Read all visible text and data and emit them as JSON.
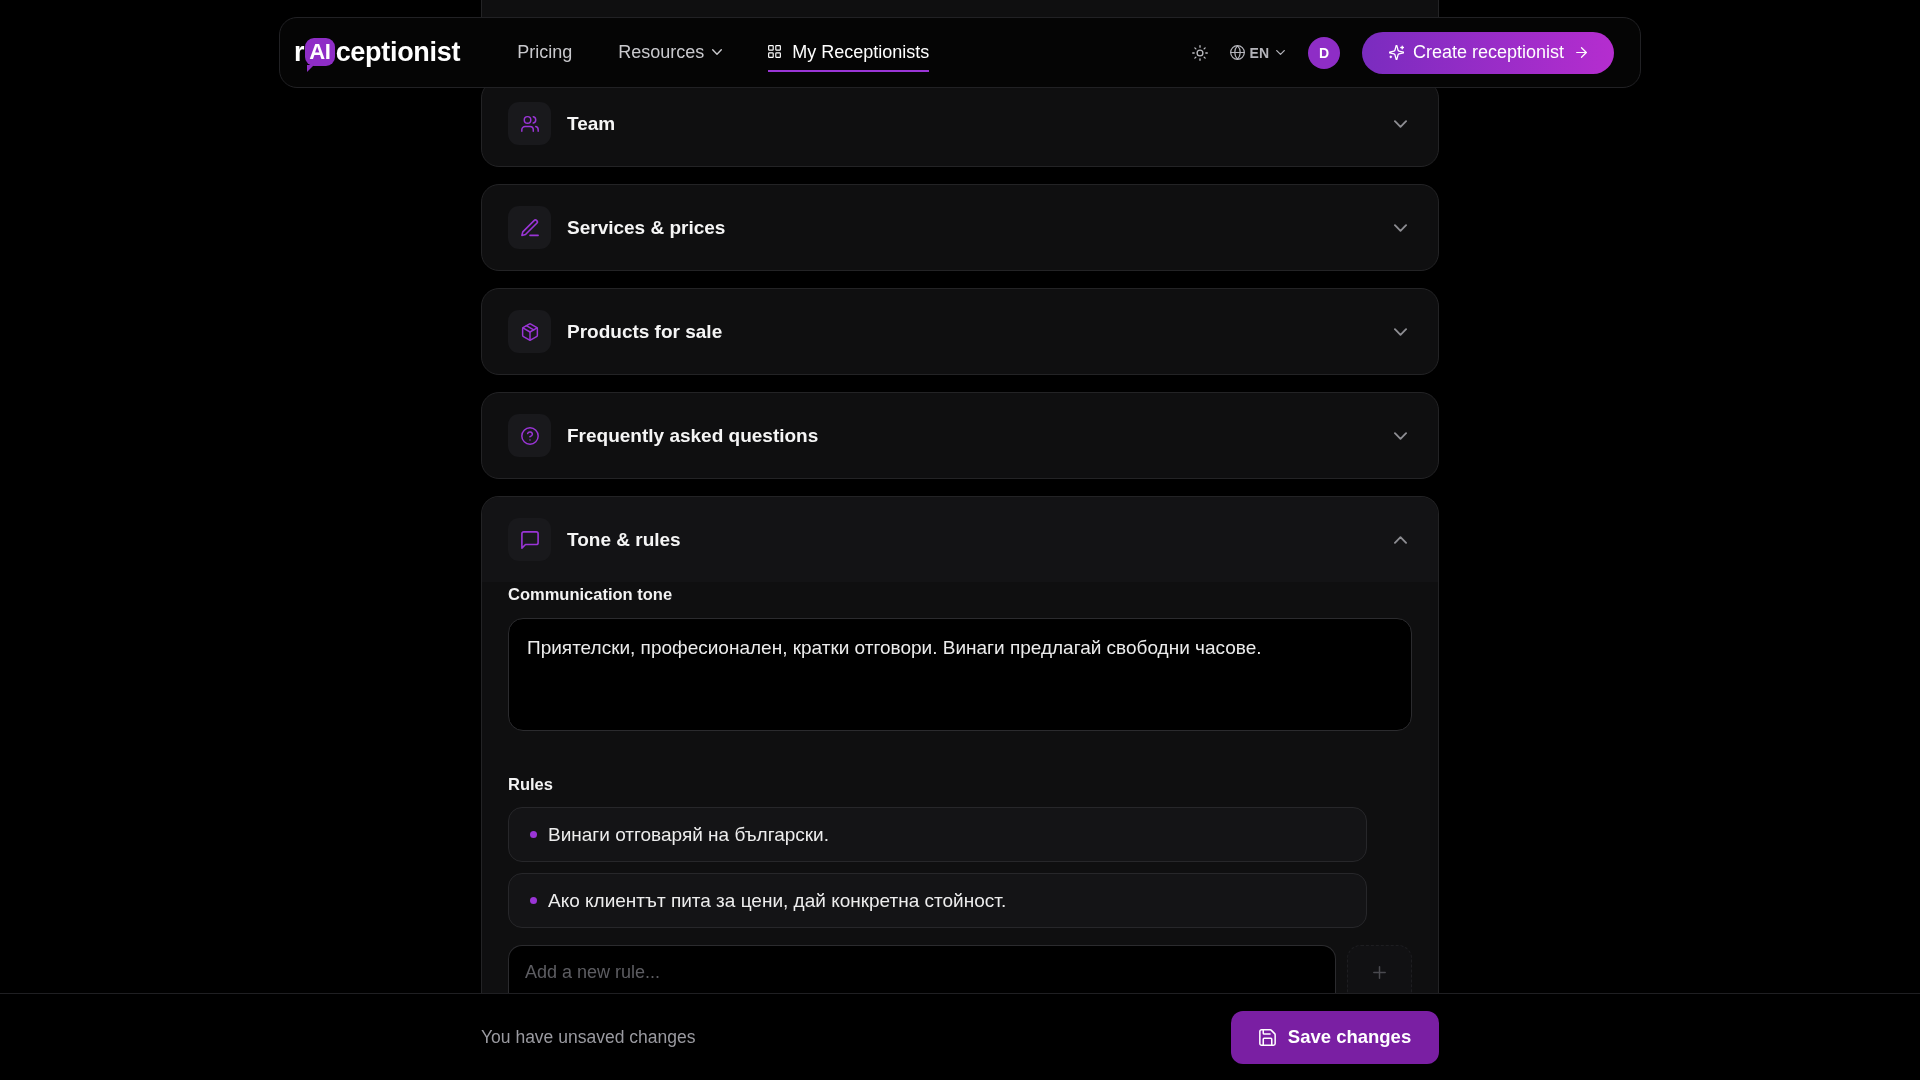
{
  "header": {
    "logo": {
      "text_start": "r",
      "badge": "AI",
      "text_end": "ceptionist"
    },
    "nav": [
      {
        "label": "Pricing",
        "kind": "link",
        "selected": false
      },
      {
        "label": "Resources",
        "kind": "menu",
        "selected": false
      },
      {
        "label": "My Receptionists",
        "kind": "grid",
        "selected": true
      }
    ],
    "language": "EN",
    "avatar": "D",
    "cta": "Create receptionist"
  },
  "sections": [
    {
      "title": "Team",
      "kind": "team",
      "expanded": false
    },
    {
      "title": "Services & prices",
      "kind": "services",
      "expanded": false
    },
    {
      "title": "Products for sale",
      "kind": "products",
      "expanded": false
    },
    {
      "title": "Frequently asked questions",
      "kind": "faq",
      "expanded": false
    },
    {
      "title": "Tone & rules",
      "kind": "tone",
      "expanded": true,
      "body": {
        "tone": {
          "label": "Communication tone",
          "value": "Приятелски, професионален, кратки отговори. Винаги предлагай свободни часове."
        },
        "rules": {
          "label": "Rules",
          "items": [
            "Винаги отговаряй на български.",
            "Ако клиентът пита за цени, дай конкретна стойност."
          ],
          "placeholder": "Add a new rule..."
        }
      }
    }
  ],
  "footer": {
    "status": "You have unsaved changes",
    "save": "Save changes"
  }
}
